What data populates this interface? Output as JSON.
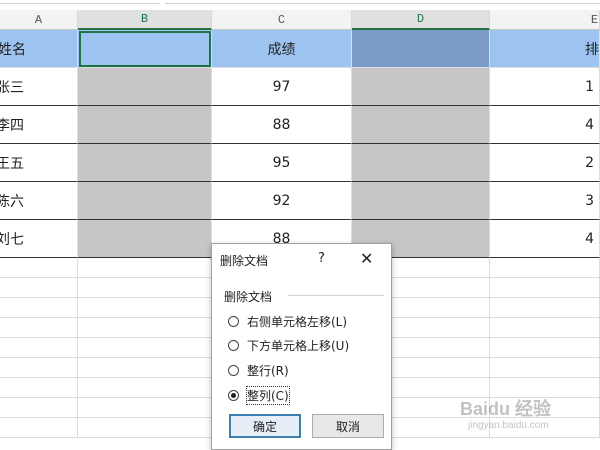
{
  "columns": [
    {
      "id": "A",
      "label": "A",
      "selected": false
    },
    {
      "id": "B",
      "label": "B",
      "selected": true
    },
    {
      "id": "C",
      "label": "C",
      "selected": false
    },
    {
      "id": "D",
      "label": "D",
      "selected": true
    },
    {
      "id": "E",
      "label": "E",
      "selected": false
    }
  ],
  "header_row": {
    "name": "姓名",
    "score": "成绩",
    "rank": "排名"
  },
  "rows": [
    {
      "name": "张三",
      "score": "97",
      "rank": "1"
    },
    {
      "name": "李四",
      "score": "88",
      "rank": "4"
    },
    {
      "name": "王五",
      "score": "95",
      "rank": "2"
    },
    {
      "name": "陈六",
      "score": "92",
      "rank": "3"
    },
    {
      "name": "刘七",
      "score": "88",
      "rank": "4"
    }
  ],
  "dialog": {
    "title": "删除文档",
    "help": "?",
    "close": "✕",
    "group_label": "删除文档",
    "options": [
      {
        "label": "右侧单元格左移(L)",
        "checked": false
      },
      {
        "label": "下方单元格上移(U)",
        "checked": false
      },
      {
        "label": "整行(R)",
        "checked": false
      },
      {
        "label": "整列(C)",
        "checked": true
      }
    ],
    "ok": "确定",
    "cancel": "取消"
  },
  "watermark": {
    "text": "Baidu 经验",
    "url": "jingyan.baidu.com"
  },
  "colors": {
    "header_fill": "#9dc3f0",
    "selected_header_fill": "#7a9cc6",
    "grey_fill": "#c6c6c6",
    "accent": "#217346"
  }
}
